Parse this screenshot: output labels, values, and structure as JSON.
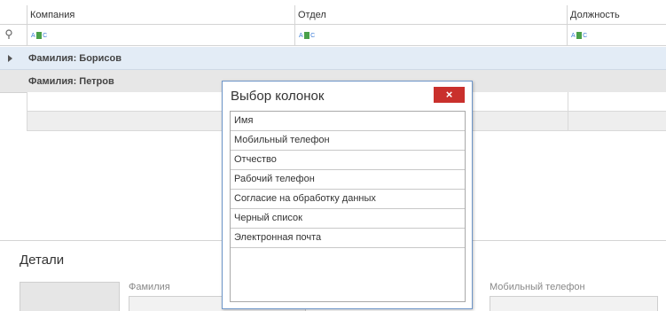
{
  "grid": {
    "columns": [
      "Компания",
      "Отдел",
      "Должность"
    ],
    "filter_glyph": "A B C",
    "groups": [
      {
        "label": "Фамилия: Борисов"
      },
      {
        "label": "Фамилия: Петров"
      }
    ]
  },
  "details": {
    "title": "Детали",
    "fields": [
      {
        "label": "Фамилия"
      },
      {
        "label": "Мобильный телефон"
      }
    ]
  },
  "dialog": {
    "title": "Выбор колонок",
    "close_label": "×",
    "items": [
      "Имя",
      "Мобильный телефон",
      "Отчество",
      "Рабочий телефон",
      "Согласие на обработку данных",
      "Черный список",
      "Электронная почта"
    ]
  },
  "colors": {
    "close_button": "#c9302c",
    "group_selected": "#e3ecf6",
    "dialog_border": "#6d95c8"
  }
}
